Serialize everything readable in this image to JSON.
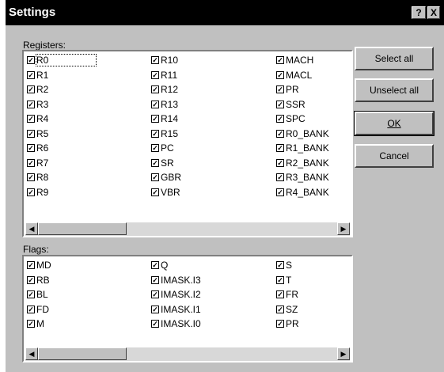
{
  "window": {
    "title": "Settings",
    "help_glyph": "?",
    "close_glyph": "X"
  },
  "registers": {
    "label": "Registers:",
    "columns": [
      [
        "R0",
        "R1",
        "R2",
        "R3",
        "R4",
        "R5",
        "R6",
        "R7",
        "R8",
        "R9"
      ],
      [
        "R10",
        "R11",
        "R12",
        "R13",
        "R14",
        "R15",
        "PC",
        "SR",
        "GBR",
        "VBR"
      ],
      [
        "MACH",
        "MACL",
        "PR",
        "SSR",
        "SPC",
        "R0_BANK",
        "R1_BANK",
        "R2_BANK",
        "R3_BANK",
        "R4_BANK"
      ]
    ]
  },
  "flags": {
    "label": "Flags:",
    "columns": [
      [
        "MD",
        "RB",
        "BL",
        "FD",
        "M"
      ],
      [
        "Q",
        "IMASK.I3",
        "IMASK.I2",
        "IMASK.I1",
        "IMASK.I0"
      ],
      [
        "S",
        "T",
        "FR",
        "SZ",
        "PR"
      ]
    ]
  },
  "buttons": {
    "select_all": "Select all",
    "unselect_all": "Unselect all",
    "ok": "OK",
    "cancel": "Cancel"
  },
  "checkbox_state": "checked",
  "colors": {
    "titlebar": "#000000",
    "dialog_face": "#c0c0c0",
    "list_bg": "#ffffff"
  }
}
